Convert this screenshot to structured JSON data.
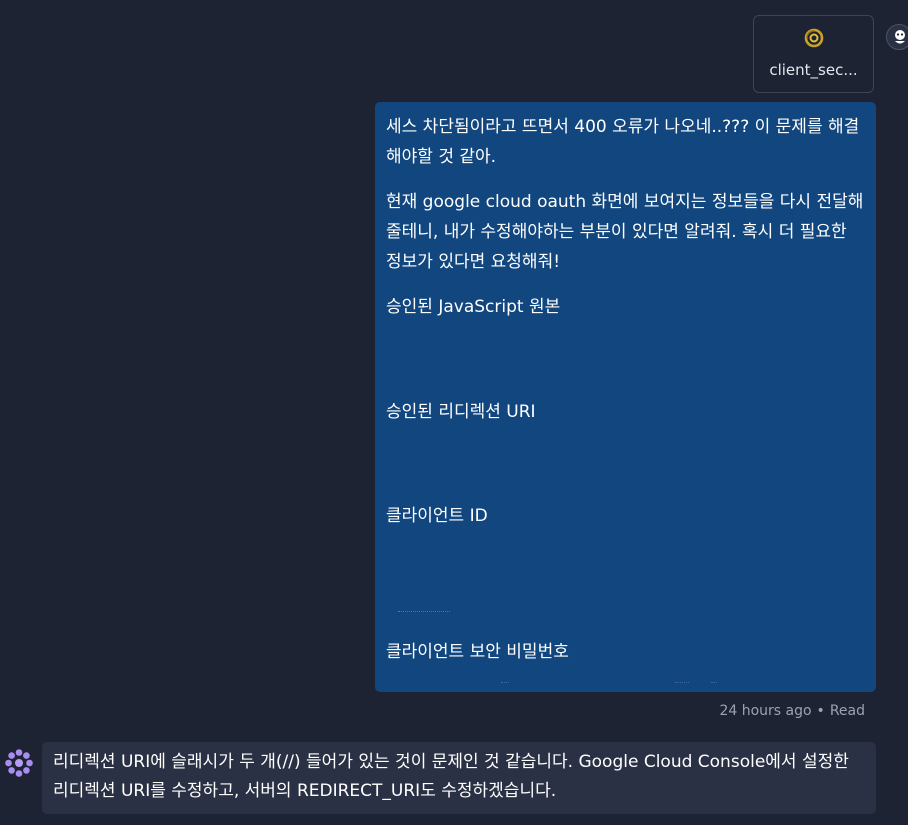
{
  "attachment": {
    "file_name": "client_sec...",
    "icon": "openai-logo-icon"
  },
  "user_message": {
    "paragraph1": "세스 차단됨이라고 뜨면서 400 오류가 나오네..??? 이 문제를 해결해야할 것 같아.",
    "paragraph2": "현재 google cloud oauth 화면에 보여지는 정보들을 다시 전달해줄테니, 내가 수정해야하는 부분이 있다면 알려줘. 혹시 더 필요한 정보가 있다면 요청해줘!",
    "label_js_origins": "승인된 JavaScript 원본",
    "label_redirect_uri": "승인된 리디렉션 URI",
    "label_client_id": "클라이언트 ID",
    "label_client_secret": "클라이언트 보안 비밀번호"
  },
  "message_meta": {
    "time": "24 hours ago",
    "separator": "•",
    "status": "Read"
  },
  "assistant_message": {
    "text": "리디렉션 URI에 슬래시가 두 개(//) 들어가 있는 것이 문제인 것 같습니다. Google Cloud Console에서 설정한 리디렉션 URI를 수정하고, 서버의 REDIRECT_URI도 수정하겠습니다.",
    "avatar_icon": "assistant-flower-icon"
  },
  "colors": {
    "background": "#1e2334",
    "user_bubble": "#11467e",
    "assistant_bubble": "#2b3144",
    "meta_text": "#9aa2b4",
    "attachment_icon": "#c9a227",
    "assistant_icon": "#a98cf0"
  }
}
